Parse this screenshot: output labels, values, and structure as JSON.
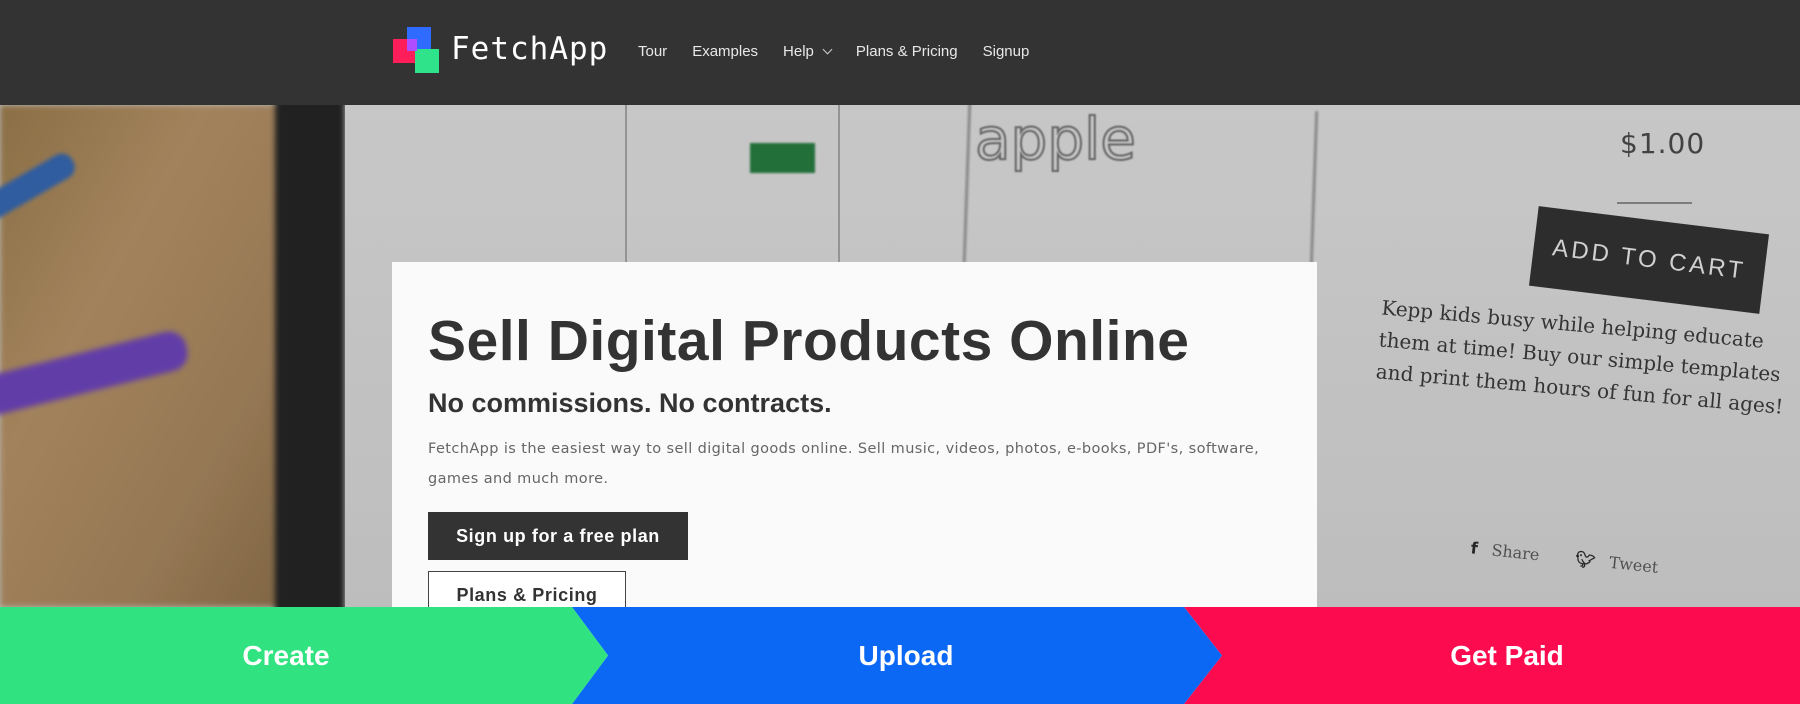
{
  "brand": {
    "name": "FetchApp",
    "colors": {
      "pink": "#ff1e5a",
      "blue": "#2f6bff",
      "green": "#2ee389"
    }
  },
  "nav": {
    "links": [
      {
        "label": "Tour"
      },
      {
        "label": "Examples"
      },
      {
        "label": "Help",
        "dropdown": true,
        "icon": "chevron-down-icon"
      },
      {
        "label": "Plans & Pricing"
      },
      {
        "label": "Signup"
      }
    ],
    "background": "#333333"
  },
  "hero": {
    "title": "Sell Digital Products Online",
    "subtitle": "No commissions. No contracts.",
    "description": "FetchApp is the easiest way to sell digital goods online. Sell music, videos, photos, e-books, PDF's, software, games and much more.",
    "primary_button": "Sign up for a free plan",
    "secondary_button": "Plans & Pricing",
    "background_image": {
      "price": "$1.00",
      "cart_button": "ADD TO CART",
      "product_text": "Kepp kids busy while helping educate them at time! Buy our simple templates and print them hours of fun for all ages!",
      "share": "Share",
      "tweet": "Tweet",
      "apple_word": "apple"
    }
  },
  "steps": [
    {
      "label": "Create",
      "color": "#30e380"
    },
    {
      "label": "Upload",
      "color": "#0a68f5"
    },
    {
      "label": "Get Paid",
      "color": "#fc0c4f"
    }
  ]
}
